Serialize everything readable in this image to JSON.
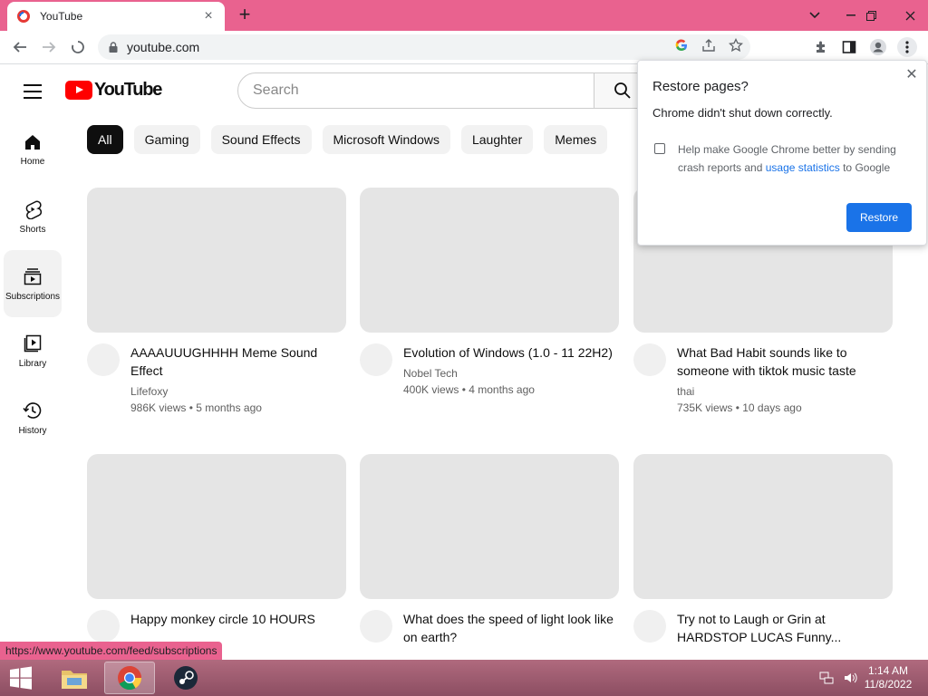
{
  "browser": {
    "tab_title": "YouTube",
    "url": "youtube.com",
    "accent_color": "#e9628f"
  },
  "youtube": {
    "logo_text": "YouTube",
    "search_placeholder": "Search",
    "guide": [
      {
        "label": "Home",
        "icon": "home-icon"
      },
      {
        "label": "Shorts",
        "icon": "shorts-icon"
      },
      {
        "label": "Subscriptions",
        "icon": "subscriptions-icon"
      },
      {
        "label": "Library",
        "icon": "library-icon"
      },
      {
        "label": "History",
        "icon": "history-icon"
      }
    ],
    "chips": [
      "All",
      "Gaming",
      "Sound Effects",
      "Microsoft Windows",
      "Laughter",
      "Memes"
    ],
    "videos": [
      {
        "title": "AAAAUUUGHHHH Meme Sound Effect",
        "channel": "Lifefoxy",
        "stats": "986K views • 5 months ago"
      },
      {
        "title": "Evolution of Windows (1.0 - 11 22H2)",
        "channel": "Nobel Tech",
        "stats": "400K views • 4 months ago"
      },
      {
        "title": "What Bad Habit sounds like to someone with tiktok music taste",
        "channel": "thai",
        "stats": "735K views • 10 days ago"
      },
      {
        "title": "Happy monkey circle 10 HOURS",
        "channel": "",
        "stats": ""
      },
      {
        "title": "What does the speed of light look like on earth?",
        "channel": "",
        "stats": ""
      },
      {
        "title": "Try not to Laugh or Grin at HARDSTOP LUCAS Funny...",
        "channel": "",
        "stats": ""
      }
    ]
  },
  "popup": {
    "title": "Restore pages?",
    "message": "Chrome didn't shut down correctly.",
    "help_prefix": "Help make Google Chrome better by sending crash reports and ",
    "help_link": "usage statistics",
    "help_suffix": " to Google",
    "restore_button": "Restore"
  },
  "status_url": "https://www.youtube.com/feed/subscriptions",
  "taskbar": {
    "time": "1:14 AM",
    "date": "11/8/2022"
  }
}
